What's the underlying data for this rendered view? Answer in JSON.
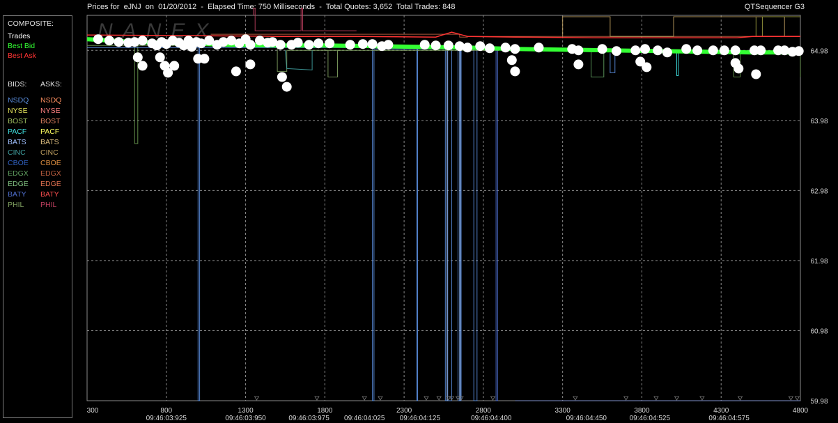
{
  "header": {
    "title": "Prices for  eJNJ  on  01/20/2012  -  Elapsed Time: 750 Milliseconds  -  Total Quotes: 3,652  Total Trades: 848",
    "app_name": "QTSequencer G3"
  },
  "watermark": "NANEX",
  "legend": {
    "composite_label": "COMPOSITE:",
    "composite_items": [
      {
        "label": "Trades",
        "color": "#ffffff"
      },
      {
        "label": "Best Bid",
        "color": "#33ff33"
      },
      {
        "label": "Best Ask",
        "color": "#ff3333"
      }
    ],
    "bids_label": "BIDS:",
    "asks_label": "ASKS:",
    "bids": [
      {
        "label": "NSDQ",
        "color": "#5b8fe0"
      },
      {
        "label": "NYSE",
        "color": "#e6e65c"
      },
      {
        "label": "BOST",
        "color": "#a0c060"
      },
      {
        "label": "PACF",
        "color": "#40e0e0"
      },
      {
        "label": "BATS",
        "color": "#a0c0ff"
      },
      {
        "label": "CINC",
        "color": "#40a0a0"
      },
      {
        "label": "CBOE",
        "color": "#3060c0"
      },
      {
        "label": "EDGX",
        "color": "#60a060"
      },
      {
        "label": "EDGE",
        "color": "#80c080"
      },
      {
        "label": "BATY",
        "color": "#5070d0"
      },
      {
        "label": "PHIL",
        "color": "#80a060"
      }
    ],
    "asks": [
      {
        "label": "NSDQ",
        "color": "#ff9060"
      },
      {
        "label": "NYSE",
        "color": "#ff8080"
      },
      {
        "label": "BOST",
        "color": "#e08060"
      },
      {
        "label": "PACF",
        "color": "#ffff60"
      },
      {
        "label": "BATS",
        "color": "#e0c080"
      },
      {
        "label": "CINC",
        "color": "#c0a060"
      },
      {
        "label": "CBOE",
        "color": "#e09040"
      },
      {
        "label": "EDGX",
        "color": "#c06040"
      },
      {
        "label": "EDGE",
        "color": "#e07050"
      },
      {
        "label": "BATY",
        "color": "#ff5050"
      },
      {
        "label": "PHIL",
        "color": "#c04060"
      }
    ]
  },
  "chart_data": {
    "type": "line",
    "xlim": [
      300,
      4800
    ],
    "ylim": [
      59.98,
      65.48
    ],
    "x_ticks": [
      300,
      800,
      1300,
      1800,
      2300,
      2800,
      3300,
      3800,
      4300,
      4800
    ],
    "y_ticks": [
      64.98,
      63.98,
      62.98,
      61.98,
      60.98,
      59.98
    ],
    "y_tick_labels": [
      "64.98",
      "63.98",
      "62.98",
      "61.98",
      "60.98",
      "59.98"
    ],
    "time_labels": [
      {
        "x": 800,
        "label": "09:46:03:925"
      },
      {
        "x": 1300,
        "label": "09:46:03:950"
      },
      {
        "x": 1700,
        "label": "09:46:03:975"
      },
      {
        "x": 2050,
        "label": "09:46:04:025"
      },
      {
        "x": 2400,
        "label": "09:46:04:125"
      },
      {
        "x": 2850,
        "label": "09:46:04:400"
      },
      {
        "x": 3450,
        "label": "09:46:04:450"
      },
      {
        "x": 3850,
        "label": "09:46:04:525"
      },
      {
        "x": 4350,
        "label": "09:46:04:575"
      }
    ],
    "grid": true,
    "best_bid": {
      "name": "Best Bid",
      "x": [
        300,
        600,
        900,
        1200,
        1500,
        1800,
        2100,
        2400,
        2700,
        3000,
        3300,
        3600,
        3900,
        4200,
        4500,
        4800
      ],
      "y": [
        65.14,
        65.1,
        65.08,
        65.06,
        65.05,
        65.05,
        65.04,
        65.03,
        65.02,
        65.0,
        64.99,
        64.98,
        64.97,
        64.96,
        64.95,
        64.95
      ]
    },
    "best_ask": {
      "name": "Best Ask",
      "x": [
        300,
        1000,
        1500,
        2000,
        2500,
        2600,
        2700,
        3000,
        3500,
        4000,
        4400,
        4500,
        4800
      ],
      "y": [
        65.2,
        65.19,
        65.18,
        65.18,
        65.17,
        65.24,
        65.18,
        65.17,
        65.16,
        65.16,
        65.16,
        65.18,
        65.18
      ]
    },
    "trades": {
      "name": "Trades",
      "x": [
        370,
        440,
        500,
        560,
        600,
        650,
        710,
        740,
        770,
        800,
        840,
        880,
        910,
        940,
        960,
        990,
        1020,
        1070,
        1120,
        1160,
        1210,
        1260,
        1300,
        1330,
        1390,
        1440,
        1470,
        1520,
        1590,
        1630,
        1700,
        1760,
        1830,
        1960,
        2040,
        2100,
        2160,
        2200,
        2430,
        2500,
        2580,
        2650,
        2700,
        2780,
        2840,
        2940,
        3000,
        3150,
        3360,
        3400,
        3550,
        3640,
        3760,
        3820,
        3900,
        3960,
        4080,
        4150,
        4250,
        4320,
        4390,
        4510,
        4550,
        4660,
        4700,
        4750,
        4790,
        620,
        650,
        760,
        790,
        810,
        850,
        1000,
        1040,
        1240,
        1330,
        1530,
        1560,
        2980,
        3000,
        3400,
        3790,
        3830,
        4390,
        4410,
        4520
      ],
      "y": [
        65.14,
        65.12,
        65.1,
        65.09,
        65.1,
        65.12,
        65.08,
        65.05,
        65.1,
        65.07,
        65.12,
        65.09,
        65.05,
        65.12,
        65.03,
        65.1,
        65.08,
        65.12,
        65.06,
        65.1,
        65.12,
        65.08,
        65.14,
        65.06,
        65.12,
        65.09,
        65.1,
        65.06,
        65.06,
        65.09,
        65.06,
        65.08,
        65.08,
        65.06,
        65.07,
        65.07,
        65.04,
        65.06,
        65.06,
        65.05,
        65.05,
        65.04,
        65.02,
        65.04,
        65.01,
        65.02,
        65.0,
        65.02,
        65.0,
        64.98,
        65.0,
        64.97,
        64.98,
        65.0,
        64.98,
        64.95,
        65.0,
        64.98,
        64.98,
        64.98,
        64.98,
        64.98,
        64.98,
        64.98,
        64.98,
        64.96,
        64.97,
        64.88,
        64.76,
        64.88,
        64.76,
        64.66,
        64.76,
        64.86,
        64.86,
        64.68,
        64.78,
        64.6,
        64.46,
        64.84,
        64.68,
        64.78,
        64.82,
        64.74,
        64.8,
        64.72,
        64.64
      ]
    }
  }
}
